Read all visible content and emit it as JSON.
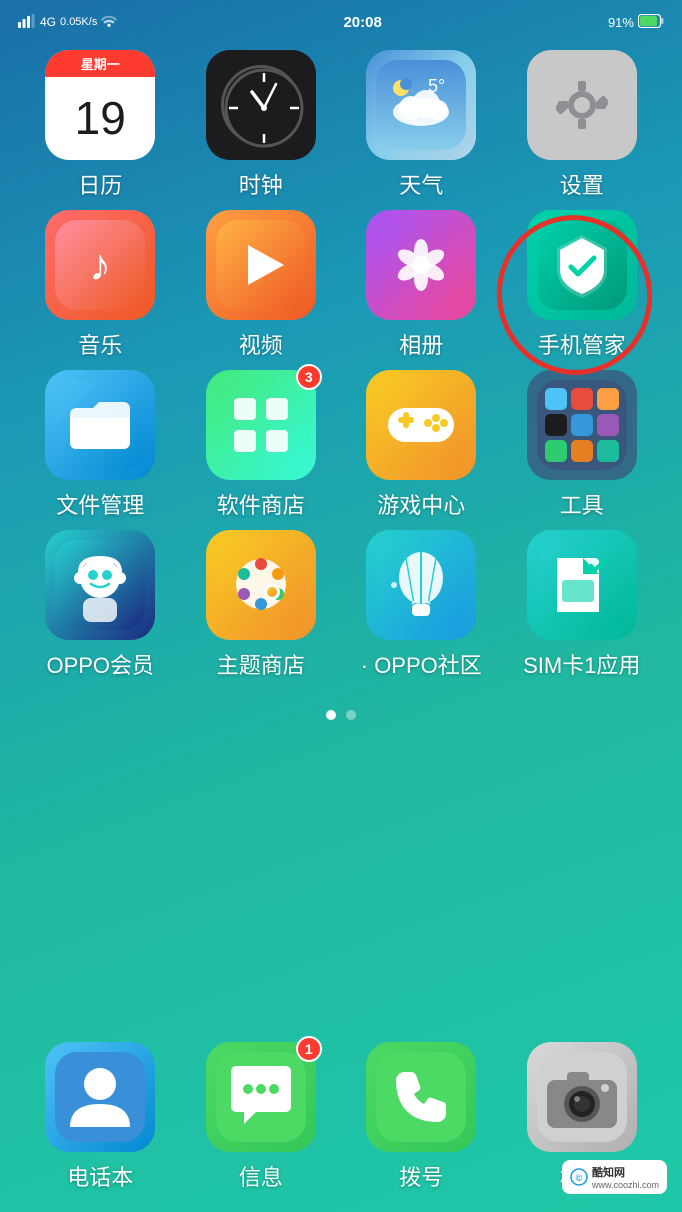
{
  "statusBar": {
    "signal": "4G",
    "speed": "0.05K/s",
    "wifi": "wifi",
    "time": "20:08",
    "battery": "91%"
  },
  "apps": {
    "row1": [
      {
        "id": "calendar",
        "label": "日历",
        "weekday": "星期一",
        "date": "19"
      },
      {
        "id": "clock",
        "label": "时钟"
      },
      {
        "id": "weather",
        "label": "天气",
        "temp": "5°"
      },
      {
        "id": "settings",
        "label": "设置"
      }
    ],
    "row2": [
      {
        "id": "music",
        "label": "音乐"
      },
      {
        "id": "video",
        "label": "视频"
      },
      {
        "id": "photos",
        "label": "相册"
      },
      {
        "id": "phonemanager",
        "label": "手机管家",
        "circled": true
      }
    ],
    "row3": [
      {
        "id": "filemanager",
        "label": "文件管理"
      },
      {
        "id": "appstore",
        "label": "软件商店",
        "badge": "3"
      },
      {
        "id": "gamecenter",
        "label": "游戏中心"
      },
      {
        "id": "tools",
        "label": "工具"
      }
    ],
    "row4": [
      {
        "id": "oppomember",
        "label": "OPPO会员"
      },
      {
        "id": "themestore",
        "label": "主题商店"
      },
      {
        "id": "oppocommunity",
        "label": "OPPO社区"
      },
      {
        "id": "simapp",
        "label": "SIM卡1应用"
      }
    ]
  },
  "dock": [
    {
      "id": "contacts",
      "label": "电话本"
    },
    {
      "id": "messages",
      "label": "信息",
      "badge": "1"
    },
    {
      "id": "phone",
      "label": "拨号"
    },
    {
      "id": "camera",
      "label": "相机"
    }
  ],
  "pageIndicators": [
    {
      "active": true
    },
    {
      "active": false
    }
  ],
  "watermark": {
    "icon": "©",
    "site": "酷知网",
    "url": "www.coozhi.com"
  }
}
